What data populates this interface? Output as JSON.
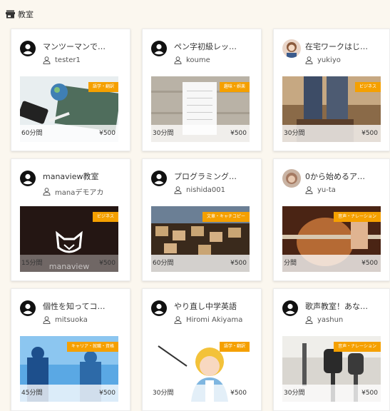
{
  "header": {
    "title": "教室",
    "icon": "store-icon"
  },
  "cards": [
    {
      "title": "マンツーマンで…",
      "user": "tester1",
      "tag": "語学・翻訳",
      "duration": "60分間",
      "price": "¥500",
      "avatar": "account-circle-icon"
    },
    {
      "title": "ペン字初級レッ…",
      "user": "koume",
      "tag": "趣味・娯楽",
      "duration": "30分間",
      "price": "¥500",
      "avatar": "account-circle-icon"
    },
    {
      "title": "在宅ワークはじ…",
      "user": "yukiyo",
      "tag": "ビジネス",
      "duration": "30分間",
      "price": "¥500",
      "avatar": "user-photo"
    },
    {
      "title": "manaview教室",
      "user": "manaデモアカ",
      "tag": "ビジネス",
      "duration": "15分間",
      "price": "¥500",
      "avatar": "account-circle-icon",
      "watermark": "manaview"
    },
    {
      "title": "プログラミング…",
      "user": "nishida001",
      "tag": "文章・キャチコピー",
      "duration": "60分間",
      "price": "¥500",
      "avatar": "account-circle-icon"
    },
    {
      "title": "0から始めるア…",
      "user": "yu-ta",
      "tag": "音声・ナレーション",
      "duration": "分間",
      "price": "¥500",
      "avatar": "user-photo"
    },
    {
      "title": "個性を知ってコ…",
      "user": "mitsuoka",
      "tag": "キャリア・就職・資格",
      "duration": "45分間",
      "price": "¥500",
      "avatar": "account-circle-icon"
    },
    {
      "title": "やり直し中学英語",
      "user": "Hiromi Akiyama",
      "tag": "語学・翻訳",
      "duration": "30分間",
      "price": "¥500",
      "avatar": "account-circle-icon"
    },
    {
      "title": "歌声教室！あな…",
      "user": "yashun",
      "tag": "音声・ナレーション",
      "duration": "30分間",
      "price": "¥500",
      "avatar": "account-circle-icon"
    }
  ],
  "colors": {
    "tag_bg": "#f5a000",
    "page_bg": "#fbf7ef"
  }
}
